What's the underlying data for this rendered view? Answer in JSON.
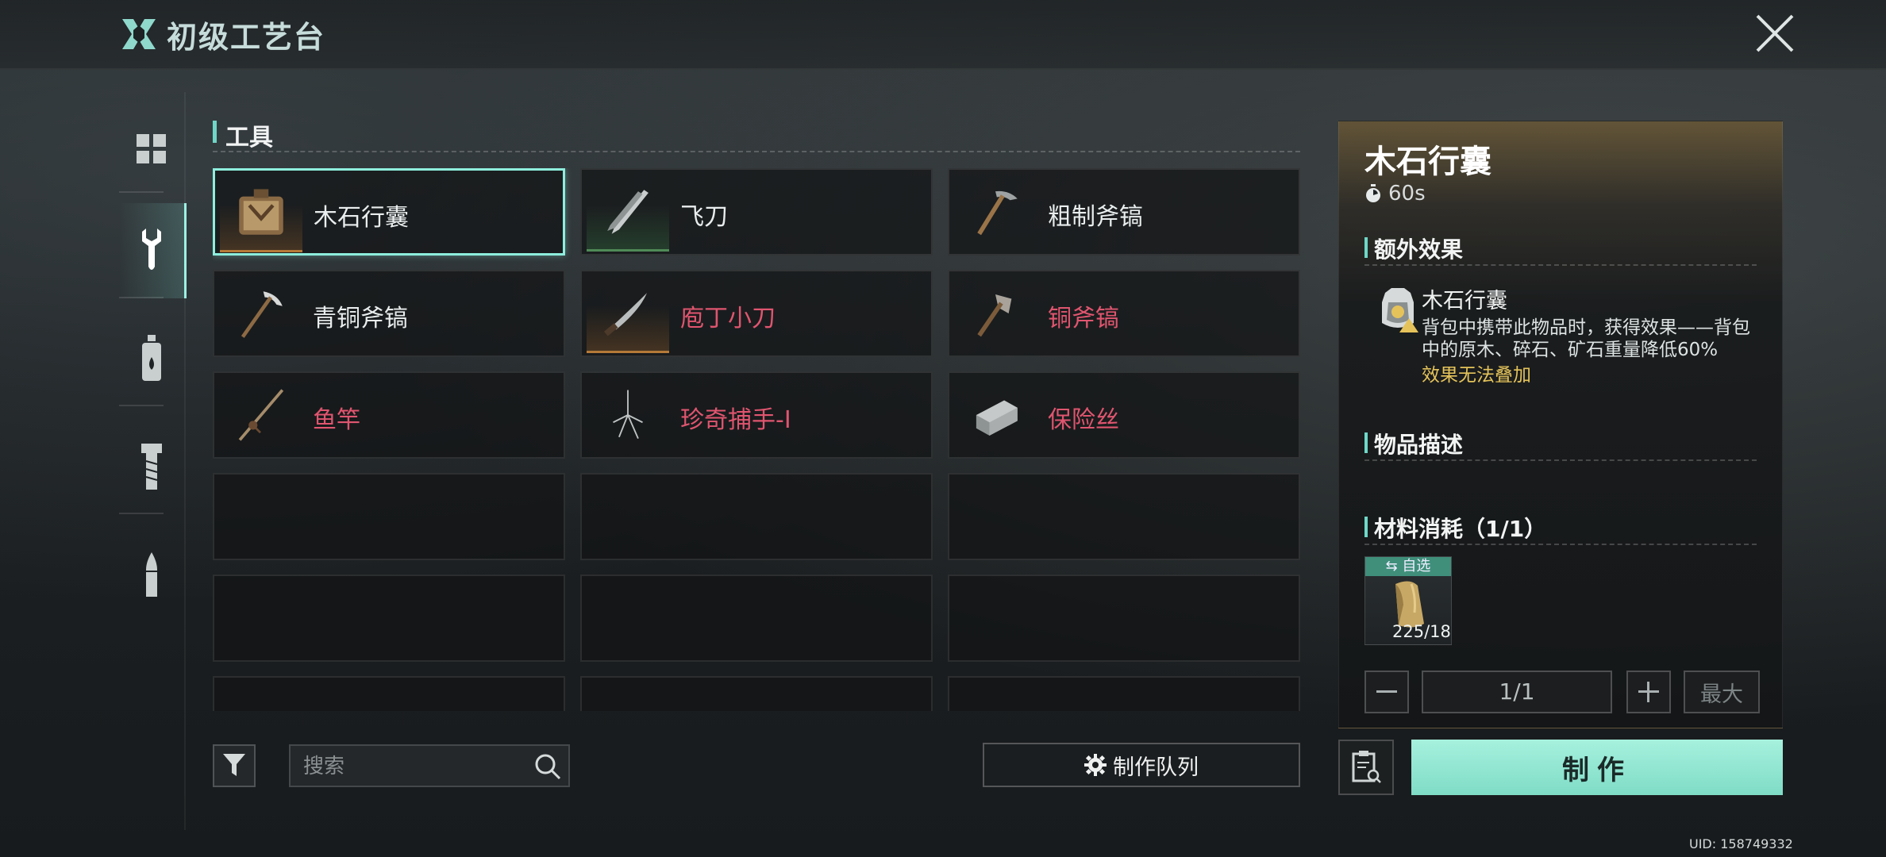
{
  "header": {
    "title": "初级工艺台"
  },
  "section": {
    "label": "工具"
  },
  "grid": {
    "items": [
      {
        "name": "木石行囊",
        "color": "#e9eded",
        "icon": "backpack-icon",
        "quality": "orange",
        "selected": true
      },
      {
        "name": "飞刀",
        "color": "#e9eded",
        "icon": "throwing-knife-icon",
        "quality": "green"
      },
      {
        "name": "粗制斧镐",
        "color": "#e9eded",
        "icon": "pickaxe-icon",
        "quality": "none"
      },
      {
        "name": "青铜斧镐",
        "color": "#e9eded",
        "icon": "bronze-pickaxe-icon",
        "quality": "none"
      },
      {
        "name": "庖丁小刀",
        "color": "#e0556f",
        "icon": "knife-icon",
        "quality": "orange"
      },
      {
        "name": "铜斧镐",
        "color": "#e0556f",
        "icon": "copper-axe-icon",
        "quality": "none"
      },
      {
        "name": "鱼竿",
        "color": "#e0556f",
        "icon": "fishing-rod-icon",
        "quality": "none"
      },
      {
        "name": "珍奇捕手-I",
        "color": "#e0556f",
        "icon": "trap-icon",
        "quality": "none"
      },
      {
        "name": "保险丝",
        "color": "#e0556f",
        "icon": "fuse-icon",
        "quality": "none"
      }
    ]
  },
  "toolbar": {
    "search_placeholder": "搜索",
    "queue_label": "制作队列"
  },
  "detail": {
    "title": "木石行囊",
    "time": "60s",
    "extra_effect_heading": "额外效果",
    "effect_name": "木石行囊",
    "effect_desc": "背包中携带此物品时，获得效果——背包中的原木、碎石、矿石重量降低60%",
    "effect_note": "效果无法叠加",
    "description_heading": "物品描述",
    "materials_heading": "材料消耗（1/1）",
    "material_tag": "自选",
    "material_count": "225/18",
    "quantity": "1/1",
    "max_label": "最大",
    "craft_label": "制作"
  },
  "footer": {
    "uid": "UID: 158749332"
  },
  "colors": {
    "accent": "#8eeedd",
    "craft_button": "#a6f1de",
    "rare_text": "#e0556f",
    "note_text": "#e5c35a"
  }
}
